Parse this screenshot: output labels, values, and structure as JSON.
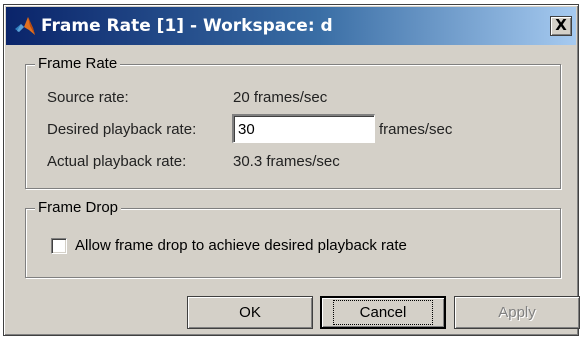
{
  "window": {
    "title": "Frame Rate [1] - Workspace: d",
    "close_label": "X"
  },
  "frame_rate": {
    "group_label": "Frame Rate",
    "source_rate_label": "Source rate:",
    "source_rate_value": "20 frames/sec",
    "desired_label": "Desired playback rate:",
    "desired_value": "30",
    "desired_unit": "frames/sec",
    "actual_label": "Actual playback rate:",
    "actual_value": "30.3 frames/sec"
  },
  "frame_drop": {
    "group_label": "Frame Drop",
    "checkbox_label": "Allow frame drop to achieve desired playback rate",
    "checked": false
  },
  "buttons": {
    "ok": "OK",
    "cancel": "Cancel",
    "apply": "Apply"
  },
  "colors": {
    "titlebar_start": "#0a246a",
    "titlebar_end": "#a6caf0",
    "face": "#d4d0c8"
  },
  "icons": {
    "title": "matlab-icon"
  }
}
